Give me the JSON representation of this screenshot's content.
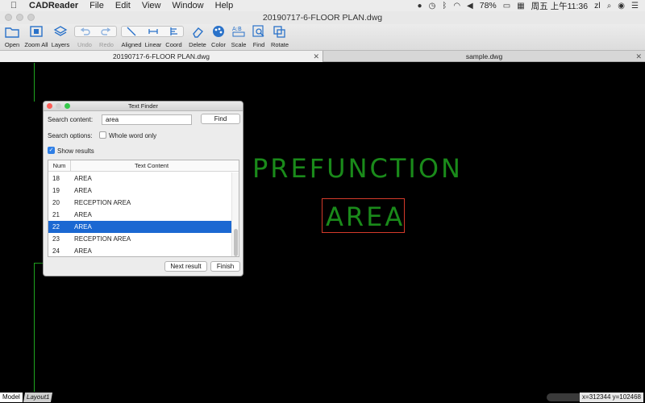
{
  "menubar": {
    "apple": "",
    "app_name": "CADReader",
    "items": [
      "File",
      "Edit",
      "View",
      "Window",
      "Help"
    ],
    "battery": "78%",
    "datetime": "周五 上午11:36",
    "user": "zl"
  },
  "window": {
    "title": "20190717-6-FLOOR PLAN.dwg"
  },
  "toolbar": {
    "open": "Open",
    "zoom_all": "Zoom All",
    "layers": "Layers",
    "undo": "Undo",
    "redo": "Redo",
    "aligned": "Aligned",
    "linear": "Linear",
    "coord": "Coord",
    "delete": "Delete",
    "color": "Color",
    "scale": "Scale",
    "find": "Find",
    "rotate": "Rotate"
  },
  "tabs": [
    {
      "label": "20190717-6-FLOOR PLAN.dwg",
      "close": "✕"
    },
    {
      "label": "sample.dwg",
      "close": "✕"
    }
  ],
  "drawing": {
    "text1": "PREFUNCTION",
    "text2": "AREA",
    "text_color": "#1a8a1a",
    "highlight_color": "#d43a2a"
  },
  "dialog": {
    "title": "Text Finder",
    "search_label": "Search content:",
    "search_value": "area",
    "find_button": "Find",
    "options_label": "Search options:",
    "whole_word_label": "Whole word only",
    "whole_word_checked": false,
    "show_results_label": "Show results",
    "show_results_checked": true,
    "columns": {
      "num": "Num",
      "text": "Text Content"
    },
    "results": [
      {
        "num": "18",
        "text": "AREA"
      },
      {
        "num": "19",
        "text": "AREA"
      },
      {
        "num": "20",
        "text": "RECEPTION AREA"
      },
      {
        "num": "21",
        "text": "AREA"
      },
      {
        "num": "22",
        "text": "AREA"
      },
      {
        "num": "23",
        "text": "RECEPTION AREA"
      },
      {
        "num": "24",
        "text": "AREA"
      }
    ],
    "selected_num": "22",
    "next_button": "Next result",
    "finish_button": "Finish"
  },
  "statusbar": {
    "layout_model": "Model",
    "layout_1": "Layout1",
    "coordinates": "x=312344 y=102468"
  }
}
